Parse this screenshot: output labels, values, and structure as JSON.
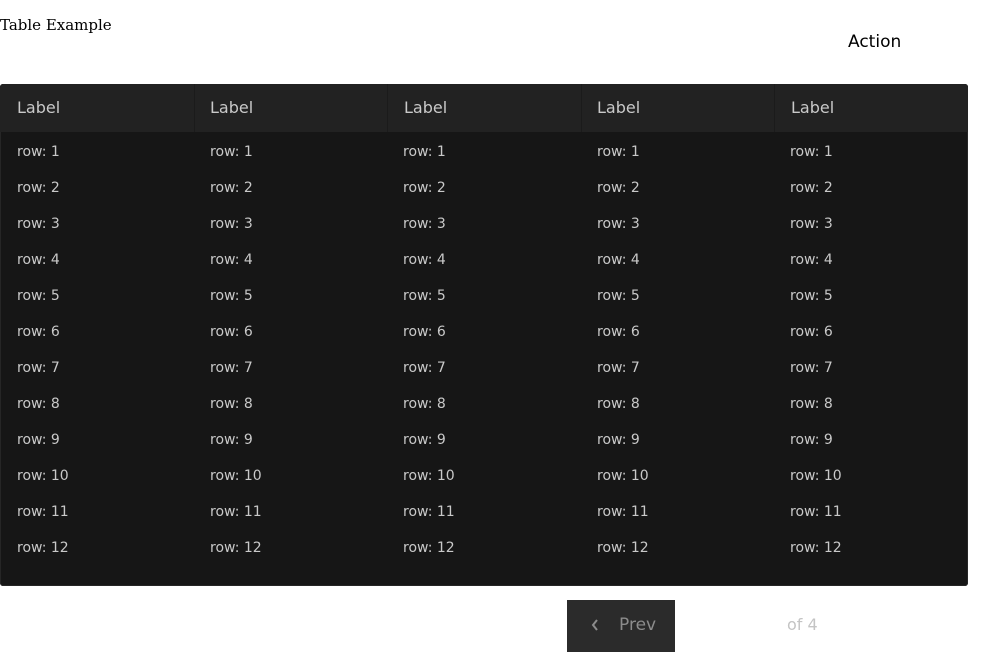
{
  "page": {
    "title": "Table Example",
    "action_label": "Action"
  },
  "table": {
    "columns": [
      "Label",
      "Label",
      "Label",
      "Label",
      "Label"
    ],
    "rows": [
      [
        "row: 1",
        "row: 1",
        "row: 1",
        "row: 1",
        "row: 1"
      ],
      [
        "row: 2",
        "row: 2",
        "row: 2",
        "row: 2",
        "row: 2"
      ],
      [
        "row: 3",
        "row: 3",
        "row: 3",
        "row: 3",
        "row: 3"
      ],
      [
        "row: 4",
        "row: 4",
        "row: 4",
        "row: 4",
        "row: 4"
      ],
      [
        "row: 5",
        "row: 5",
        "row: 5",
        "row: 5",
        "row: 5"
      ],
      [
        "row: 6",
        "row: 6",
        "row: 6",
        "row: 6",
        "row: 6"
      ],
      [
        "row: 7",
        "row: 7",
        "row: 7",
        "row: 7",
        "row: 7"
      ],
      [
        "row: 8",
        "row: 8",
        "row: 8",
        "row: 8",
        "row: 8"
      ],
      [
        "row: 9",
        "row: 9",
        "row: 9",
        "row: 9",
        "row: 9"
      ],
      [
        "row: 10",
        "row: 10",
        "row: 10",
        "row: 10",
        "row: 10"
      ],
      [
        "row: 11",
        "row: 11",
        "row: 11",
        "row: 11",
        "row: 11"
      ],
      [
        "row: 12",
        "row: 12",
        "row: 12",
        "row: 12",
        "row: 12"
      ]
    ]
  },
  "pagination": {
    "prev_label": "Prev",
    "prev_icon": "chevron-left-icon",
    "of_text": "of 4"
  },
  "colors": {
    "table_background": "#161616",
    "header_background": "#222222",
    "cell_text": "#c9c9c9",
    "button_background": "#2b2b2b"
  }
}
